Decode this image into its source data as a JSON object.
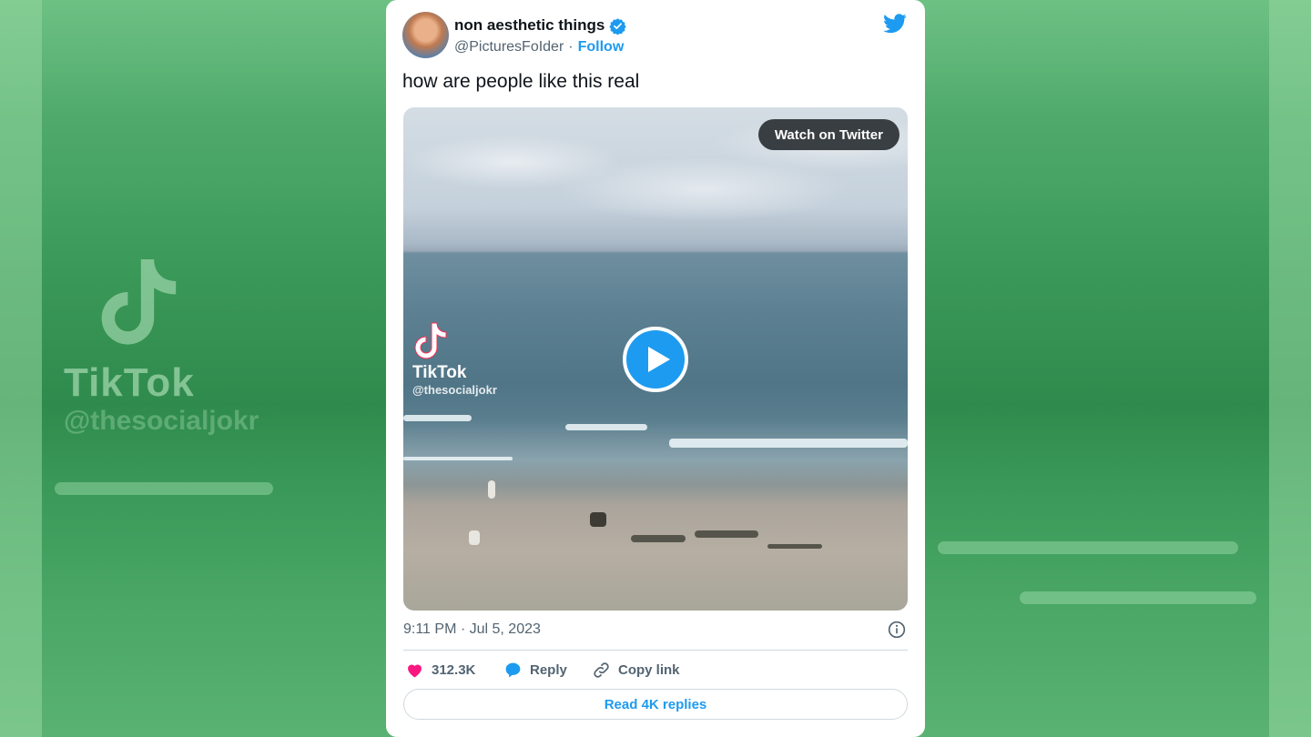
{
  "background": {
    "watermark_brand": "TikTok",
    "watermark_handle": "@thesocialjokr",
    "accent": "#3f9a59"
  },
  "tweet": {
    "author_name": "non aesthetic things",
    "verified_icon": "verified-badge-icon",
    "author_handle": "@PicturesFoIder",
    "separator": "·",
    "follow_label": "Follow",
    "text": "how are people like this real",
    "media": {
      "watch_label": "Watch on Twitter",
      "play_icon": "play-icon",
      "tiktok_brand": "TikTok",
      "tiktok_handle": "@thesocialjokr"
    },
    "timestamp": "9:11 PM · Jul 5, 2023",
    "likes": "312.3K",
    "reply_label": "Reply",
    "copy_link_label": "Copy link",
    "read_replies_label": "Read 4K replies"
  },
  "colors": {
    "twitter_blue": "#1d9bf0",
    "like_pink": "#f91880",
    "text": "#0f1419",
    "muted": "#536471"
  }
}
